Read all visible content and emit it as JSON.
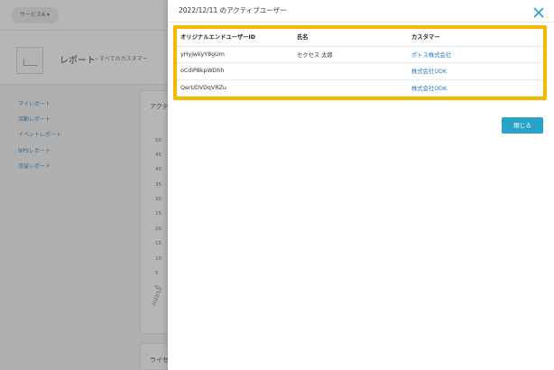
{
  "background": {
    "service_selector": "サービスA ▾",
    "page_title": "レポート",
    "breadcrumb": "› すべてのカスタマー",
    "sidebar": [
      {
        "label": "マイレポート"
      },
      {
        "label": "活動レポート"
      },
      {
        "label": "イベントレポート"
      },
      {
        "label": "NPSレポート"
      },
      {
        "label": "収益レポート"
      }
    ],
    "card_title": "アクテ",
    "card2_title": "ライセ",
    "ticks": [
      "50",
      "45",
      "40",
      "35",
      "30",
      "25",
      "20",
      "15",
      "10",
      "5",
      "0"
    ],
    "x_label": "2022/12/"
  },
  "modal": {
    "title": "2022/12/11 のアクティブユーザー",
    "close_icon": "close-icon",
    "highlight_color": "#f5b800",
    "columns": [
      "オリジナルエンドユーザーID",
      "氏名",
      "カスタマー"
    ],
    "rows": [
      {
        "id": "yHyjwkyY8gUm",
        "name": "セクセス 太郎",
        "customer": "ポトス株式会社"
      },
      {
        "id": "oCdiP8kpWDhh",
        "name": "",
        "customer": "株式会社ODK"
      },
      {
        "id": "QerUDVDqVRZu",
        "name": "",
        "customer": "株式会社ODK"
      }
    ],
    "close_button": "閉じる",
    "accent": "#2aa3c9"
  }
}
